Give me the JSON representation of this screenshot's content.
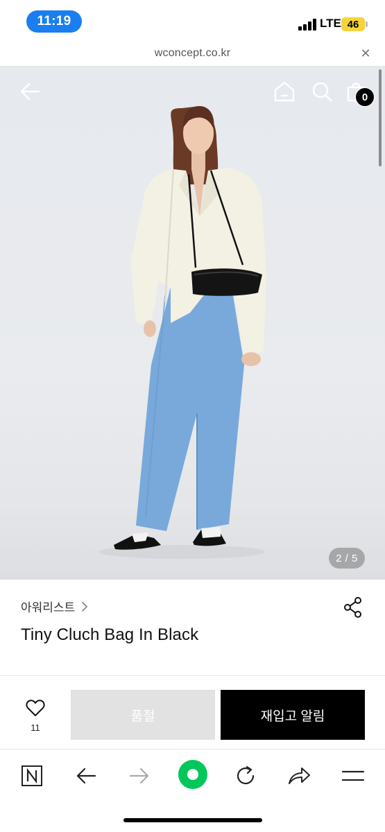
{
  "status_bar": {
    "time": "11:19",
    "network": "LTE",
    "battery": "46"
  },
  "url_bar": {
    "url": "wconcept.co.kr",
    "close": "✕"
  },
  "product_image": {
    "cart_count": "0",
    "page_indicator": "2 / 5"
  },
  "product": {
    "brand": "아워리스트",
    "name": "Tiny Cluch Bag In Black"
  },
  "actions": {
    "wish_count": "11",
    "sold_out_label": "품절",
    "restock_label": "재입고 알림"
  },
  "colors": {
    "time_pill": "#1a7ef0",
    "battery": "#f5d33a",
    "naver_green": "#03c75a",
    "restock_button": "#000000",
    "sold_out_button": "#e2e2e2"
  },
  "icons": [
    "back-arrow-icon",
    "home-icon",
    "search-icon",
    "shopping-bag-icon",
    "share-icon",
    "heart-icon",
    "naver-n-icon",
    "browser-back-icon",
    "browser-forward-icon",
    "naver-green-dot-icon",
    "refresh-icon",
    "share-arrow-icon",
    "menu-icon"
  ]
}
